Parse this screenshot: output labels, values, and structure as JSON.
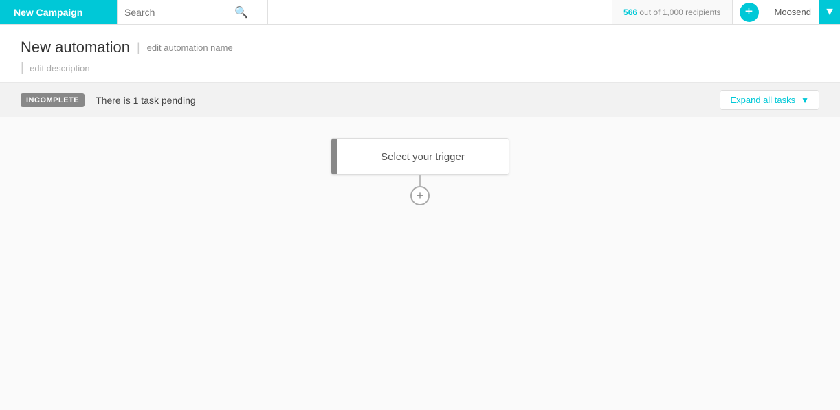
{
  "topbar": {
    "new_campaign_label": "New Campaign",
    "search_placeholder": "Search",
    "recipients_count": "566",
    "recipients_total": "1,000",
    "recipients_label": "out of",
    "recipients_suffix": "recipients",
    "add_btn_label": "+",
    "user_name": "Moosend",
    "chevron": "▼"
  },
  "page": {
    "title": "New automation",
    "edit_name_label": "edit automation name",
    "edit_description_label": "edit description"
  },
  "status_bar": {
    "badge_label": "INCOMPLETE",
    "task_pending_text": "There is 1 task pending",
    "expand_all_label": "Expand all tasks",
    "expand_chevron": "▼"
  },
  "canvas": {
    "trigger_label": "Select your trigger",
    "add_step_icon": "+"
  }
}
